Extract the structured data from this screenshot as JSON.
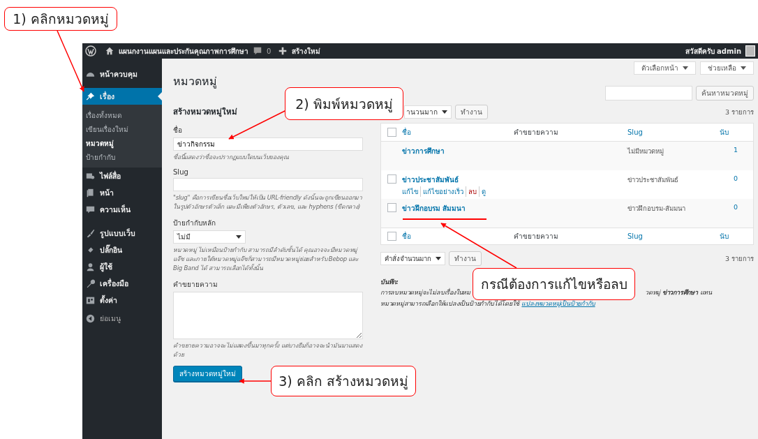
{
  "annotations": [
    {
      "kind": "callout",
      "text": "1) คลิกหมวดหมู่"
    },
    {
      "kind": "callout",
      "text": "2) พิมพ์หมวดหมู่"
    },
    {
      "kind": "callout",
      "text": "3) คลิก สร้างหมวดหมู่"
    },
    {
      "kind": "callout",
      "text": "กรณีต้องการแก้ไขหรือลบ"
    }
  ],
  "admin_bar": {
    "site_name": "แผนกงานแผนและประกันคุณภาพการศึกษา",
    "comment_count": "0",
    "new_label": "สร้างใหม่",
    "greeting": "สวัสดีครับ admin"
  },
  "sidebar": {
    "items": [
      {
        "label": "หน้าควบคุม",
        "selected": false
      },
      {
        "label": "เรื่อง",
        "selected": true,
        "children": [
          {
            "label": "เรื่องทั้งหมด",
            "selected": false
          },
          {
            "label": "เขียนเรื่องใหม่",
            "selected": false
          },
          {
            "label": "หมวดหมู่",
            "selected": true
          },
          {
            "label": "ป้ายกำกับ",
            "selected": false
          }
        ]
      },
      {
        "label": "ไฟล์สื่อ",
        "selected": false
      },
      {
        "label": "หน้า",
        "selected": false
      },
      {
        "label": "ความเห็น",
        "selected": false
      },
      {
        "label": "รูปแบบเว็บ",
        "selected": false
      },
      {
        "label": "ปลั๊กอิน",
        "selected": false
      },
      {
        "label": "ผู้ใช้",
        "selected": false
      },
      {
        "label": "เครื่องมือ",
        "selected": false
      },
      {
        "label": "ตั้งค่า",
        "selected": false
      }
    ],
    "collapse_label": "ย่อเมนู"
  },
  "screen_tabs": [
    "ตัวเลือกหน้า",
    "ช่วยเหลือ"
  ],
  "page_title": "หมวดหมู่",
  "form": {
    "heading": "สร้างหมวดหมู่ใหม่",
    "name": {
      "label": "ชื่อ",
      "value": "ข่าวกิจกรรม",
      "help": "ชื่อนี้แสดงว่าชื่อจะปรากฏแบบใดบนเว็บของคุณ"
    },
    "slug": {
      "label": "Slug",
      "help": "\"slug\" คือการเขียนชื่อเว็บใหม่ให้เป็น URL-friendly ดังนั้นจะถูกเขียนออกมาในรูปตัวอักษรตัวเล็ก และมีเพียงตัวอักษร, ตัวเลข, และ hyphens (ขีดกลาง)"
    },
    "parent": {
      "label": "ป้ายกำกับหลัก",
      "value": "ไม่มี",
      "help": "หมวดหมู่ ไม่เหมือนป้ายกำกับ สามารถมีลำดับชั้นได้ คุณอาจจะมีหมวดหมู่แจ๊ซ และภายใต้หมวดหมู่แจ๊ซก็สามารถมีหมวดหมู่ย่อยสำหรับ Bebop และ Big Band ได้ สามารถเลือกได้ทั้งนั้น"
    },
    "description": {
      "label": "คำขยายความ",
      "help": "คำขยายความอาจจะไม่แสดงขึ้นมาทุกครั้ง แต่บางธีมก็อาจจะนำมันมาแสดงด้วย"
    },
    "submit": "สร้างหมวดหมู่ใหม่"
  },
  "search": {
    "button": "ค้นหาหมวดหมู่"
  },
  "bulk_top": {
    "select": "านวนมาก",
    "apply": "ทำงาน",
    "count": "3 รายการ"
  },
  "table": {
    "columns": [
      "ชื่อ",
      "คำขยายความ",
      "Slug",
      "นับ"
    ],
    "select_all_checked": false,
    "rows": [
      {
        "name": "ข่าวการศึกษา",
        "slug": "ไม่มีหมวดหมู่",
        "count": "1",
        "kind": "default"
      },
      {
        "name": "ข่าวประชาสัมพันธ์",
        "slug": "ข่าวประชาสัมพันธ์",
        "count": "0",
        "kind": "normal",
        "checked": false,
        "actions": [
          {
            "label": "แก้ไข",
            "kind": "link"
          },
          {
            "label": "แก้ไขอย่างเร็ว",
            "kind": "link"
          },
          {
            "label": "ลบ",
            "kind": "delete"
          },
          {
            "label": "ดู",
            "kind": "link"
          }
        ]
      },
      {
        "name": "ข่าวฝึกอบรม สัมมนา",
        "slug": "ข่าวฝึกอบรม-สัมมนา",
        "count": "0",
        "kind": "normal",
        "checked": false
      }
    ],
    "footer_columns": [
      "ชื่อ",
      "คำขยายความ",
      "Slug",
      "นับ"
    ]
  },
  "bulk_bottom": {
    "select": "คำสั่งจำนวนมาก",
    "apply": "ทำงาน",
    "count": "3 รายการ"
  },
  "note": {
    "title": "บันทึก:",
    "line1_left": "การลบหมวดหมู่จะไม่ลบเรื่องในหม",
    "line1_right": "วดหมู่ **ข่าวการศึกษา** แทน",
    "line2": "หมวดหมู่สามารถเลือกให้แปลงเป็นป้ายกำกับได้โดยใช้",
    "link": "แปลงหมวดหมู่เป็นป้ายกำกับ"
  }
}
